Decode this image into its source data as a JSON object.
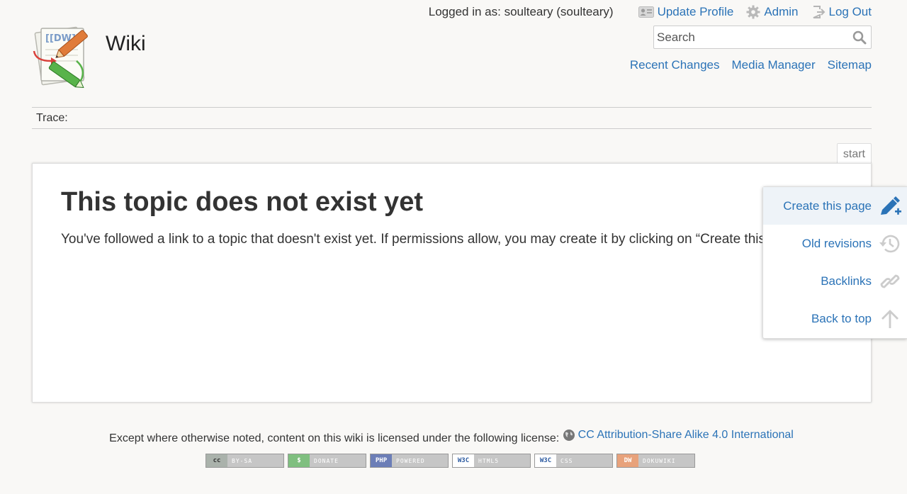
{
  "site": {
    "title": "Wiki",
    "logo_icon": "dokuwiki-logo-icon"
  },
  "user_tools": {
    "logged_in": "Logged in as: soulteary (soulteary)",
    "update_profile": "Update Profile",
    "admin": "Admin",
    "logout": "Log Out"
  },
  "search": {
    "placeholder": "Search"
  },
  "site_tools": {
    "recent_changes": "Recent Changes",
    "media_manager": "Media Manager",
    "sitemap": "Sitemap"
  },
  "breadcrumbs": {
    "label": "Trace:"
  },
  "page": {
    "id": "start",
    "heading": "This topic does not exist yet",
    "message": "You've followed a link to a topic that doesn't exist yet. If permissions allow, you may create it by clicking on “Create this page”."
  },
  "page_tools": [
    {
      "label": "Create this page",
      "icon": "pencil-plus-icon"
    },
    {
      "label": "Old revisions",
      "icon": "history-icon"
    },
    {
      "label": "Backlinks",
      "icon": "link-icon"
    },
    {
      "label": "Back to top",
      "icon": "arrow-up-icon"
    }
  ],
  "footer": {
    "license_text": "Except where otherwise noted, content on this wiki is licensed under the following license:",
    "license_link": "CC Attribution-Share Alike 4.0 International",
    "badges": [
      {
        "lead": "cc",
        "text": "BY-SA",
        "color": "#aab2ab"
      },
      {
        "lead": "$",
        "text": "DONATE",
        "color": "#7fbf7f"
      },
      {
        "lead": "PHP",
        "text": "POWERED",
        "color": "#6c7eb7"
      },
      {
        "lead": "W3C",
        "text": "HTML5",
        "color": "#ffffff"
      },
      {
        "lead": "W3C",
        "text": "CSS",
        "color": "#ffffff"
      },
      {
        "lead": "DW",
        "text": "DOKUWIKI",
        "color": "#e8a27b"
      }
    ]
  }
}
